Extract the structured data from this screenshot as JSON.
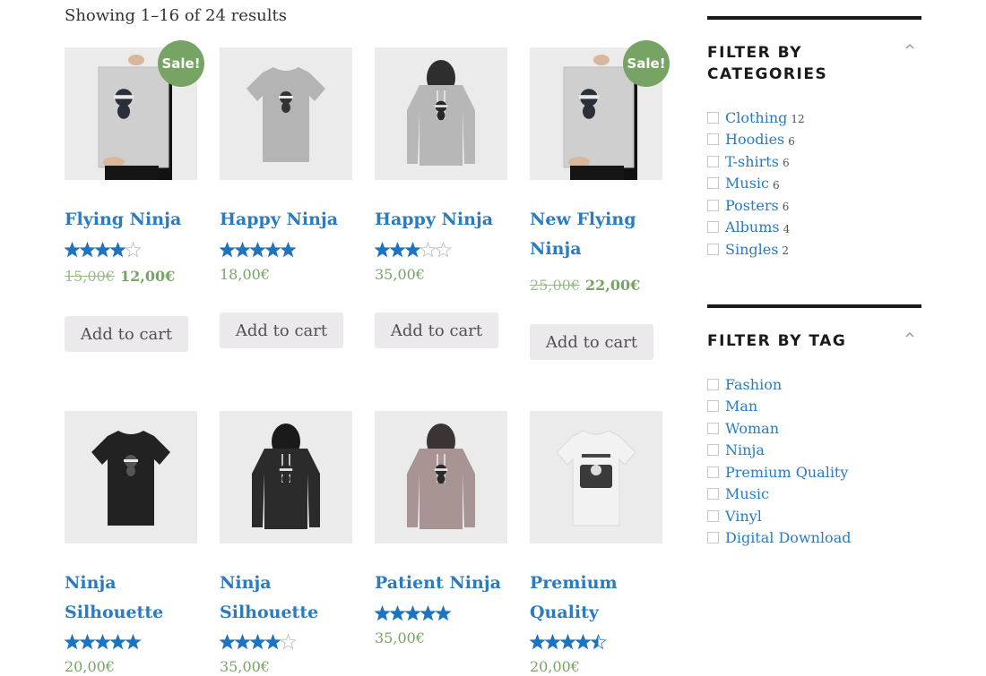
{
  "result_count": "Showing 1–16 of 24 results",
  "products": [
    {
      "title_lines": [
        "Flying Ninja"
      ],
      "rating": 4,
      "sale": true,
      "sale_label": "Sale!",
      "old_price": "15,00€",
      "price": "12,00€",
      "button": "Add to cart",
      "image": "poster-ninja"
    },
    {
      "title_lines": [
        "Happy Ninja"
      ],
      "rating": 5,
      "sale": false,
      "old_price": "",
      "price": "18,00€",
      "button": "Add to cart",
      "image": "grey-tshirt"
    },
    {
      "title_lines": [
        "Happy Ninja"
      ],
      "rating": 3,
      "sale": false,
      "old_price": "",
      "price": "35,00€",
      "button": "Add to cart",
      "image": "grey-hoodie"
    },
    {
      "title_lines": [
        "New Flying",
        "Ninja"
      ],
      "rating": null,
      "sale": true,
      "sale_label": "Sale!",
      "old_price": "25,00€",
      "price": "22,00€",
      "button": "Add to cart",
      "image": "poster-ninja"
    },
    {
      "title_lines": [
        "Ninja",
        "Silhouette"
      ],
      "rating": 5,
      "sale": false,
      "old_price": "",
      "price": "20,00€",
      "image": "black-tshirt"
    },
    {
      "title_lines": [
        "Ninja",
        "Silhouette"
      ],
      "rating": 4,
      "sale": false,
      "old_price": "",
      "price": "35,00€",
      "image": "black-hoodie"
    },
    {
      "title_lines": [
        "Patient Ninja"
      ],
      "rating": 5,
      "sale": false,
      "old_price": "",
      "price": "35,00€",
      "image": "pink-hoodie"
    },
    {
      "title_lines": [
        "Premium",
        "Quality"
      ],
      "rating": 4.5,
      "sale": false,
      "old_price": "",
      "price": "20,00€",
      "image": "white-tshirt"
    }
  ],
  "sidebar": {
    "categories": {
      "title_lines": [
        "FILTER BY",
        "CATEGORIES"
      ],
      "items": [
        {
          "label": "Clothing",
          "count": "12"
        },
        {
          "label": "Hoodies",
          "count": "6"
        },
        {
          "label": "T-shirts",
          "count": "6"
        },
        {
          "label": "Music",
          "count": "6"
        },
        {
          "label": "Posters",
          "count": "6"
        },
        {
          "label": "Albums",
          "count": "4"
        },
        {
          "label": "Singles",
          "count": "2"
        }
      ]
    },
    "tags": {
      "title_lines": [
        "FILTER BY TAG"
      ],
      "items": [
        {
          "label": "Fashion"
        },
        {
          "label": "Man"
        },
        {
          "label": "Woman"
        },
        {
          "label": "Ninja"
        },
        {
          "label": "Premium Quality"
        },
        {
          "label": "Music"
        },
        {
          "label": "Vinyl"
        },
        {
          "label": "Digital Download"
        }
      ]
    }
  },
  "colors": {
    "link": "#2a7bbf",
    "price": "#77a464",
    "sale_badge": "#77a464",
    "star": "#1e73be",
    "button_bg": "#ebe9eb"
  }
}
